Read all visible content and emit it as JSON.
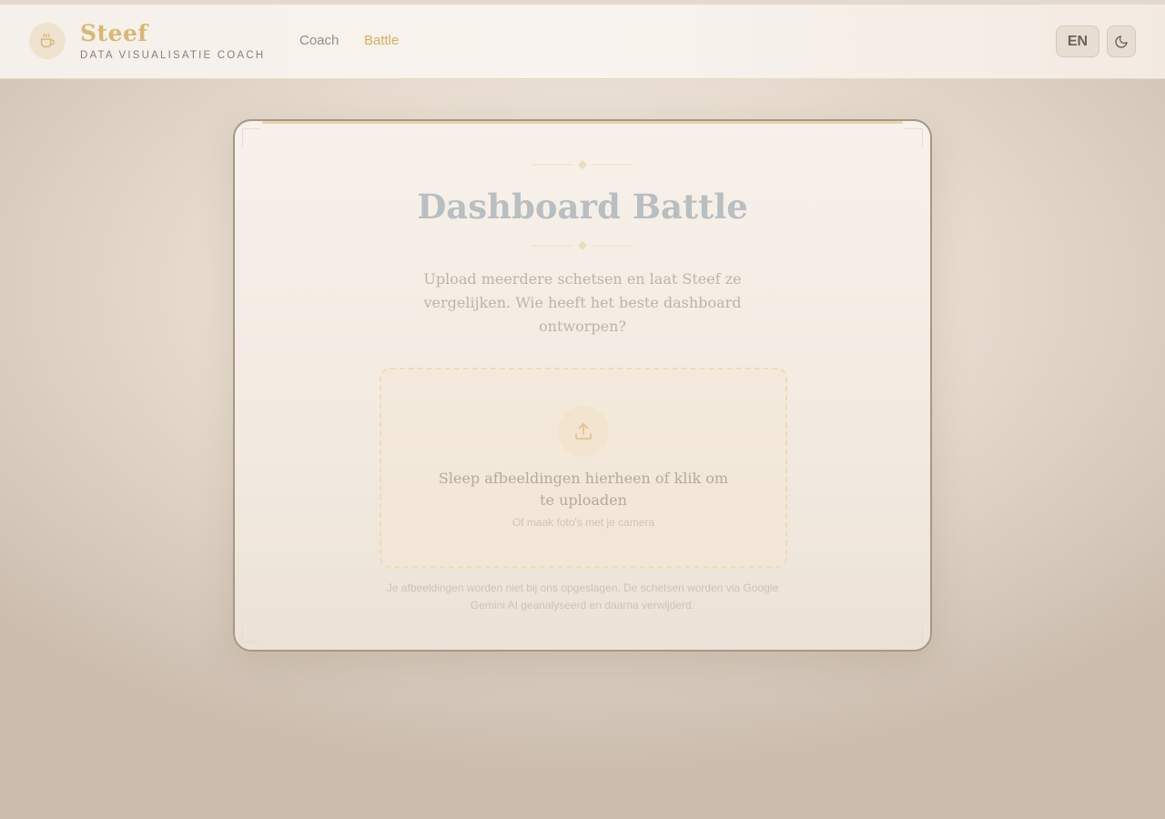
{
  "header": {
    "brand_name": "Steef",
    "brand_subtitle": "DATA VISUALISATIE COACH",
    "nav": {
      "coach": "Coach",
      "battle": "Battle"
    },
    "language_button": "EN",
    "logo_icon": "coffee-cup-icon",
    "theme_icon": "moon-icon"
  },
  "main": {
    "title": "Dashboard Battle",
    "subtitle": "Upload meerdere schetsen en laat Steef ze vergelijken. Wie heeft het beste dashboard ontworpen?",
    "dropzone": {
      "icon": "upload-icon",
      "main_text": "Sleep afbeeldingen hierheen of klik om te uploaden",
      "sub_text": "Of maak foto's met je camera"
    },
    "privacy_note": "Je afbeeldingen worden niet bij ons opgeslagen. De schetsen worden via Google Gemini AI geanalyseerd en daarna verwijderd."
  },
  "colors": {
    "accent": "#d6ad5c",
    "brand": "#d9b874",
    "title": "#b9bec1"
  }
}
